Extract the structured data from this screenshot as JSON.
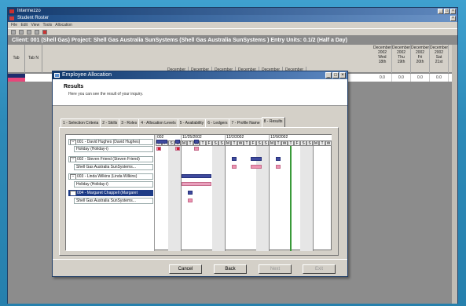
{
  "app": {
    "title": "Intermezzo",
    "child_title": "Student Roster",
    "menu": "File  Edit  View  Tools  Allocation",
    "client_bar": "Client: 001 (Shell Gas)   Project: Shell Gas Australia SunSystems (Shell Gas Australia SunSystems )   Entry Units: 0.1/2 (Half a Day)"
  },
  "grid": {
    "tab_cols": [
      "Tab",
      "Tab N"
    ],
    "day_headers": [
      {
        "line1": "December",
        "line2": "2002",
        "line3": "Wed",
        "line4": "18th"
      },
      {
        "line1": "December",
        "line2": "2002",
        "line3": "Thu",
        "line4": "19th"
      },
      {
        "line1": "December",
        "line2": "2002",
        "line3": "Fri",
        "line4": "20th"
      },
      {
        "line1": "December",
        "line2": "2002",
        "line3": "Sat",
        "line4": "21st"
      }
    ],
    "row_values": [
      "0.0",
      "0.0",
      "0.0",
      "0.0"
    ],
    "top_headers": [
      "December",
      "December",
      "December",
      "December",
      "December",
      "December"
    ]
  },
  "dialog": {
    "title": "Employee Allocation",
    "header_title": "Results",
    "header_subtitle": "Here you can see the result of your inquiry.",
    "tabs": [
      "1 - Selection Criteria",
      "2 - Skills",
      "3 - Roles",
      "4 - Allocation Levels",
      "5 - Availability",
      "6 - Ledgers",
      "7 - Profile Name",
      "8 - Results"
    ],
    "tree": [
      {
        "label": "001 - David Hughes (David Hughes)",
        "kind": "exp"
      },
      {
        "label": "Holiday (Holiday-i)",
        "kind": "child"
      },
      {
        "label": "002 - Steven Friend (Steven Friend)",
        "kind": "exp"
      },
      {
        "label": "Shell Gas Australia SunSystems...",
        "kind": "child"
      },
      {
        "label": "003 - Linda Wilkins (Linda Wilkins)",
        "kind": "exp"
      },
      {
        "label": "Holiday (Holiday-i)",
        "kind": "child"
      },
      {
        "label": "004 - Margaret Chappell (Margaret",
        "kind": "sel"
      },
      {
        "label": "Shell Gas Australia SunSystems...",
        "kind": "child"
      }
    ],
    "weeks": [
      "002",
      "11/25/2002",
      "12/2/2002",
      "12/9/2002"
    ],
    "day_letters": [
      "T",
      "F",
      "S",
      "S",
      "M",
      "T",
      "W",
      "T",
      "F",
      "S",
      "S",
      "M",
      "T",
      "W",
      "T",
      "F",
      "S",
      "S",
      "M",
      "T",
      "W",
      "T",
      "F",
      "S",
      "S",
      "M",
      "T",
      "W"
    ],
    "buttons": {
      "cancel": "Cancel",
      "back": "Back",
      "next": "Next",
      "exit": "Exit"
    }
  }
}
